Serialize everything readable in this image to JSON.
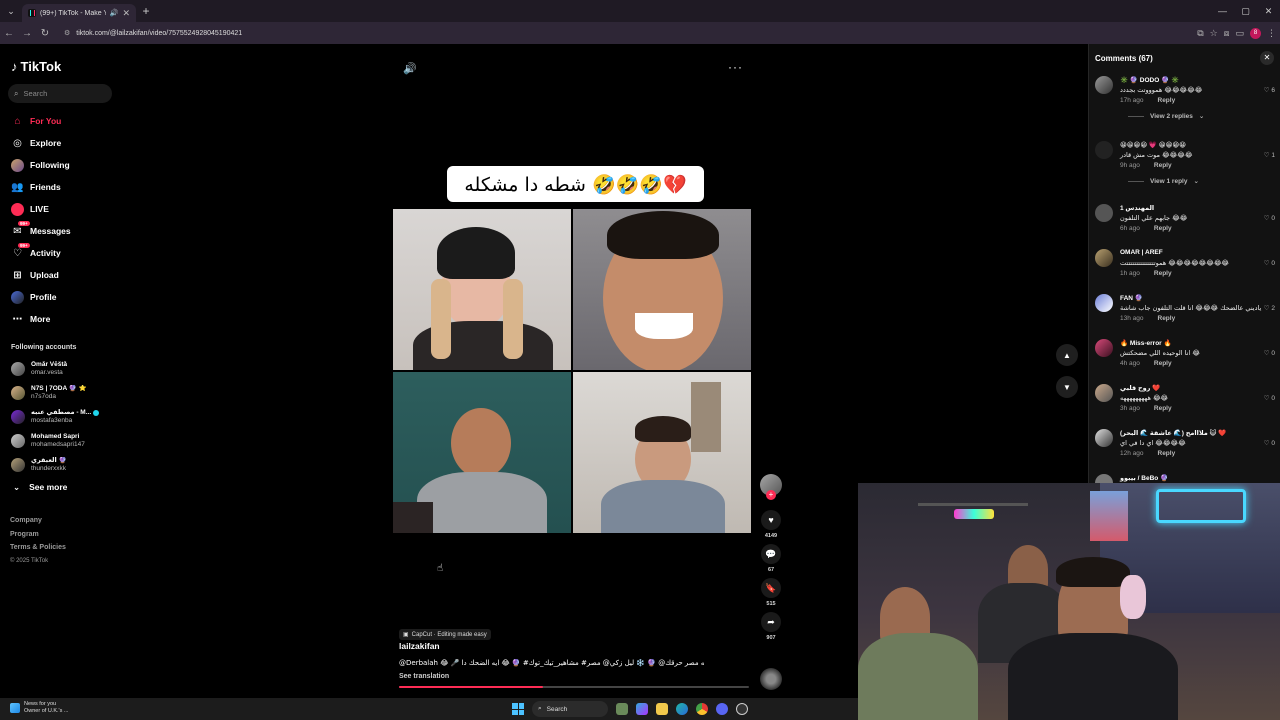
{
  "browser": {
    "tab_title": "(99+) TikTok - Make Your D",
    "url": "tiktok.com/@lailzakifan/video/7575524928045190421",
    "profile_badge": "8"
  },
  "sidebar": {
    "logo": "TikTok",
    "search_placeholder": "Search",
    "nav": [
      {
        "label": "For You",
        "icon": "home-icon"
      },
      {
        "label": "Explore",
        "icon": "compass-icon"
      },
      {
        "label": "Following",
        "icon": "following-avatar-icon"
      },
      {
        "label": "Friends",
        "icon": "friends-icon"
      },
      {
        "label": "LIVE",
        "icon": "live-icon"
      },
      {
        "label": "Messages",
        "icon": "messages-icon",
        "badge": "99+"
      },
      {
        "label": "Activity",
        "icon": "activity-icon",
        "badge": "99+"
      },
      {
        "label": "Upload",
        "icon": "upload-icon"
      },
      {
        "label": "Profile",
        "icon": "profile-icon"
      },
      {
        "label": "More",
        "icon": "more-icon"
      }
    ],
    "following_title": "Following accounts",
    "accounts": [
      {
        "name": "Ōmår Vēštå",
        "handle": "omar.vesta"
      },
      {
        "name": "N7S | 7ODA 🔮 ⭐",
        "handle": "n7s7oda"
      },
      {
        "name": "مصطفي عنبه - M...",
        "handle": "mostafa3enba"
      },
      {
        "name": "Mohamed Sapri",
        "handle": "mohamedsapri147"
      },
      {
        "name": "العبقري 🔮",
        "handle": "thunderxxkk"
      }
    ],
    "see_more": "See more",
    "footer": [
      "Company",
      "Program",
      "Terms & Policies"
    ],
    "copyright": "© 2025 TikTok"
  },
  "video": {
    "caption_overlay": "شطه دا مشكله 🤣🤣🤣💔",
    "capcut_label": "CapCut · Editing made easy",
    "author": "lailzakifan",
    "description": "@Derbalah 😂 🎤 شطه مصر حرقك@ 🔮 ❄️ ليل زكي@ مصر# مشاهير_تيك_توك# 🔮 😂 ايه الضحك دا",
    "see_translation": "See translation",
    "progress": 0.41
  },
  "actions": {
    "likes": "4149",
    "comments": "67",
    "saves": "515",
    "shares": "907"
  },
  "comments_panel": {
    "title": "Comments (67)",
    "items": [
      {
        "name": "✳️ 🔮 DODO 🔮 ✳️",
        "text": "هموووتت بجددد 😂😂😂😂😂",
        "time": "17h ago",
        "reply": "Reply",
        "likes": "6",
        "view_replies": "View 2 replies"
      },
      {
        "name": "😀😀😀😀 💗 😀😀😀😀",
        "text": "موت مش قادر 😂😂😂😂",
        "time": "9h ago",
        "reply": "Reply",
        "likes": "1",
        "view_replies": "View 1 reply"
      },
      {
        "name": "المهندس 1",
        "text": "جابهم علي التلفون 😂😂",
        "time": "6h ago",
        "reply": "Reply",
        "likes": "0"
      },
      {
        "name": "OMAR | AREF",
        "text": "هموتتتتتتتتتتتتتتتت 😂😂😂😂😂😂😂😂",
        "time": "1h ago",
        "reply": "Reply",
        "likes": "0"
      },
      {
        "name": "FAN 🔮",
        "text": "ياديني عالضحك 😂😂😂 انا قلت التلفون جاب شاشة",
        "time": "13h ago",
        "reply": "Reply",
        "likes": "2"
      },
      {
        "name": "🔥 Miss-error 🔥",
        "text": "انا الوحيده اللي مضحكتش 😂",
        "time": "4h ago",
        "reply": "Reply",
        "likes": "0"
      },
      {
        "name": "روح قلبي ❤️",
        "text": "هههههههههه 😂😂",
        "time": "3h ago",
        "reply": "Reply",
        "likes": "0"
      },
      {
        "name": "(عاشقة 🌊 البحر 🌊) ملااامح 😺 ❤️",
        "text": "اي دا في اي 😂😂😂😂",
        "time": "12h ago",
        "reply": "Reply",
        "likes": "0"
      },
      {
        "name": "بيبوو / BeBo 🔮",
        "text": "",
        "time": "",
        "reply": "",
        "likes": ""
      }
    ]
  },
  "taskbar": {
    "news_title": "News for you",
    "news_sub": "Owner of U.K.'s ...",
    "search_label": "Search"
  },
  "colors": {
    "accent": "#fe2c55",
    "background": "#000000",
    "panel": "#121212"
  }
}
